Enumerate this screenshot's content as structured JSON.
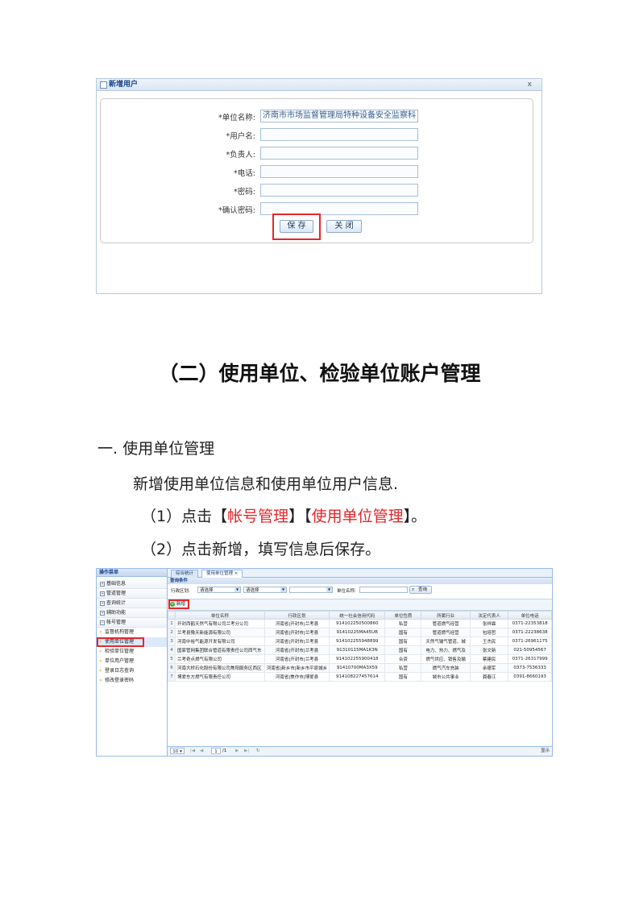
{
  "dialog": {
    "title": "新增用户",
    "close": "x",
    "fields": [
      {
        "label": "*单位名称:",
        "value": "济南市市场监督管理局特种设备安全监察科"
      },
      {
        "label": "*用户名:",
        "value": ""
      },
      {
        "label": "*负责人:",
        "value": ""
      },
      {
        "label": "*电话:",
        "value": ""
      },
      {
        "label": "*密码:",
        "value": ""
      },
      {
        "label": "*确认密码:",
        "value": ""
      }
    ],
    "save_label": "保 存",
    "close_label": "关 闭"
  },
  "doc": {
    "heading": "（二）使用单位、检验单位账户管理",
    "section": "一.   使用单位管理",
    "para": "新增使用单位信息和使用单位用户信息.",
    "step1_prefix": "（1）点击【",
    "step1_link1": "帐号管理",
    "step1_mid": "】【",
    "step1_link2": "使用单位管理",
    "step1_suffix": "】。",
    "step2": "（2）点击新增，填写信息后保存。"
  },
  "admin": {
    "side_title": "操作菜单",
    "menu": [
      "基础信息",
      "管道管理",
      "查询统计",
      "辅助功能",
      "帐号管理"
    ],
    "menu_marks": [
      "+",
      "+",
      "+",
      "+",
      "−"
    ],
    "submenu": [
      "监督机构管理",
      "使用单位管理",
      "检验单位管理",
      "单位用户管理",
      "登录日志查询",
      "修改登录密码"
    ],
    "tabs": [
      "综合统计",
      "使用单位管理 ×"
    ],
    "query_title": "查询条件",
    "region_label": "行政区划:",
    "select1": "请选择",
    "select2": "请选择",
    "select3": "",
    "unit_name_label": "单位名称:",
    "query_btn": "查询",
    "add_btn": "新增",
    "columns": [
      "",
      "单位名称",
      "行政区划",
      "统一社会信用代码",
      "单位性质",
      "所属行业",
      "法定代表人",
      "单位电话"
    ],
    "rows": [
      [
        "1",
        "开封西鹤天然气有限公司兰考分公司",
        "河南省|开封市|兰考县",
        "914102250500860",
        "私营",
        "管道燃气经营",
        "张祥霖",
        "0371-22353818"
      ],
      [
        "2",
        "兰考县豫天新能源有限公司",
        "河南省|开封市|兰考县",
        "91410225MA45UB",
        "国有",
        "管道燃气经营",
        "包培哲",
        "0371-22238638"
      ],
      [
        "3",
        "河南中裕气能源开发有限公司",
        "河南省|开封市|兰考县",
        "914102255948899",
        "国有",
        "天然气输气管道、城",
        "王杰民",
        "0371-26961175"
      ],
      [
        "4",
        "国家管网集团联合管道有限责任公司西气东",
        "河南省|开封市|兰考县",
        "91310115MA1K3N",
        "国有",
        "电力、热力、燃气及",
        "张文新",
        "021-50954567"
      ],
      [
        "5",
        "兰考奇点燃气有限公司",
        "河南省|开封市|兰考县",
        "914102255900418",
        "合资",
        "燃气供应、销售及输",
        "蔡建民",
        "0371-26317999"
      ],
      [
        "6",
        "河南大桥石化股份有限公司焦阳服务区西区",
        "河南省|新乡市|新乡市平原城乡",
        "91410700MA3X59",
        "私营",
        "燃气汽车充装",
        "余德军",
        "0373-7536333"
      ],
      [
        "7",
        "博爱东方燃气有限责任公司",
        "河南省|焦作市|博爱县",
        "914108227457614",
        "国有",
        "城市公共事业",
        "聂春江",
        "0391-8660193"
      ]
    ],
    "pager": {
      "size": "10",
      "first": "|◀",
      "prev": "◀",
      "page": "1",
      "total": "/1",
      "next": "▶",
      "last": "▶|",
      "refresh": "↻",
      "info": "显示"
    }
  }
}
